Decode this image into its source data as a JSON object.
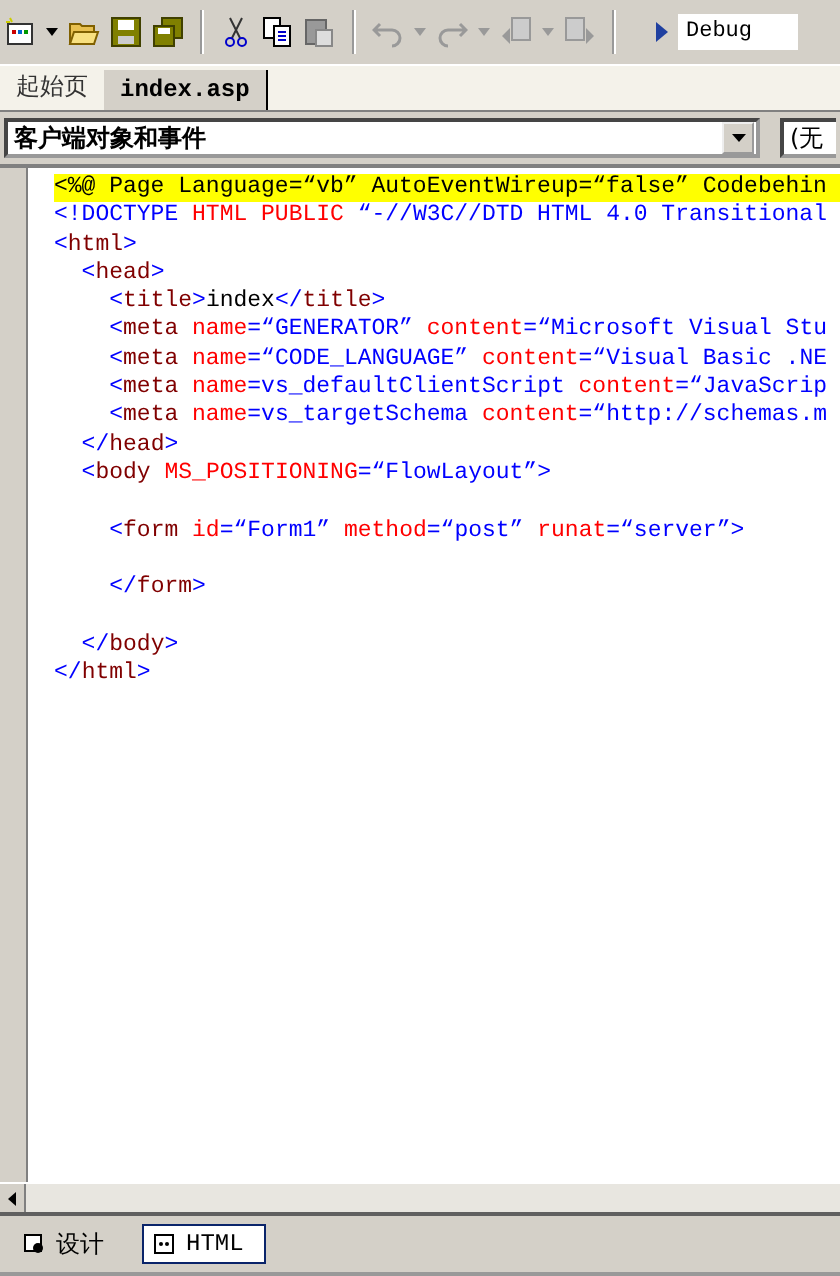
{
  "toolbar": {
    "configuration": "Debug"
  },
  "tabs": [
    {
      "label": "起始页",
      "selected": false
    },
    {
      "label": "index.asp",
      "selected": true
    }
  ],
  "object_dropdown": {
    "value": "客户端对象和事件"
  },
  "event_dropdown": {
    "value": "(无"
  },
  "code_lines": [
    {
      "highlighted": true,
      "tokens": [
        {
          "t": "<%@ Page Language=“vb” AutoEventWireup=“false” Codebehin",
          "kind": "plain"
        }
      ]
    },
    {
      "highlighted": false,
      "tokens": [
        {
          "t": "<!DOCTYPE ",
          "kind": "value"
        },
        {
          "t": "HTML PUBLIC ",
          "kind": "attr"
        },
        {
          "t": "“-//W3C//DTD HTML 4.0 Transitional",
          "kind": "value"
        }
      ]
    },
    {
      "highlighted": false,
      "tokens": [
        {
          "t": "<",
          "kind": "value"
        },
        {
          "t": "html",
          "kind": "tag"
        },
        {
          "t": ">",
          "kind": "value"
        }
      ]
    },
    {
      "highlighted": false,
      "tokens": [
        {
          "t": "  <",
          "kind": "value"
        },
        {
          "t": "head",
          "kind": "tag"
        },
        {
          "t": ">",
          "kind": "value"
        }
      ]
    },
    {
      "highlighted": false,
      "tokens": [
        {
          "t": "    <",
          "kind": "value"
        },
        {
          "t": "title",
          "kind": "tag"
        },
        {
          "t": ">",
          "kind": "value"
        },
        {
          "t": "index",
          "kind": "plain"
        },
        {
          "t": "</",
          "kind": "value"
        },
        {
          "t": "title",
          "kind": "tag"
        },
        {
          "t": ">",
          "kind": "value"
        }
      ]
    },
    {
      "highlighted": false,
      "tokens": [
        {
          "t": "    <",
          "kind": "value"
        },
        {
          "t": "meta ",
          "kind": "tag"
        },
        {
          "t": "name",
          "kind": "attr"
        },
        {
          "t": "=“GENERATOR” ",
          "kind": "value"
        },
        {
          "t": "content",
          "kind": "attr"
        },
        {
          "t": "=“Microsoft Visual Stu",
          "kind": "value"
        }
      ]
    },
    {
      "highlighted": false,
      "tokens": [
        {
          "t": "    <",
          "kind": "value"
        },
        {
          "t": "meta ",
          "kind": "tag"
        },
        {
          "t": "name",
          "kind": "attr"
        },
        {
          "t": "=“CODE_LANGUAGE” ",
          "kind": "value"
        },
        {
          "t": "content",
          "kind": "attr"
        },
        {
          "t": "=“Visual Basic .NE",
          "kind": "value"
        }
      ]
    },
    {
      "highlighted": false,
      "tokens": [
        {
          "t": "    <",
          "kind": "value"
        },
        {
          "t": "meta ",
          "kind": "tag"
        },
        {
          "t": "name",
          "kind": "attr"
        },
        {
          "t": "=vs_defaultClientScript ",
          "kind": "value"
        },
        {
          "t": "content",
          "kind": "attr"
        },
        {
          "t": "=“JavaScrip",
          "kind": "value"
        }
      ]
    },
    {
      "highlighted": false,
      "tokens": [
        {
          "t": "    <",
          "kind": "value"
        },
        {
          "t": "meta ",
          "kind": "tag"
        },
        {
          "t": "name",
          "kind": "attr"
        },
        {
          "t": "=vs_targetSchema ",
          "kind": "value"
        },
        {
          "t": "content",
          "kind": "attr"
        },
        {
          "t": "=“http://schemas.m",
          "kind": "value"
        }
      ]
    },
    {
      "highlighted": false,
      "tokens": [
        {
          "t": "  </",
          "kind": "value"
        },
        {
          "t": "head",
          "kind": "tag"
        },
        {
          "t": ">",
          "kind": "value"
        }
      ]
    },
    {
      "highlighted": false,
      "tokens": [
        {
          "t": "  <",
          "kind": "value"
        },
        {
          "t": "body ",
          "kind": "tag"
        },
        {
          "t": "MS_POSITIONING",
          "kind": "attr"
        },
        {
          "t": "=“FlowLayout”>",
          "kind": "value"
        }
      ]
    },
    {
      "highlighted": false
    },
    {
      "highlighted": false,
      "tokens": [
        {
          "t": "    <",
          "kind": "value"
        },
        {
          "t": "form ",
          "kind": "tag"
        },
        {
          "t": "id",
          "kind": "attr"
        },
        {
          "t": "=“Form1” ",
          "kind": "value"
        },
        {
          "t": "method",
          "kind": "attr"
        },
        {
          "t": "=“post” ",
          "kind": "value"
        },
        {
          "t": "runat",
          "kind": "attr"
        },
        {
          "t": "=“server”>",
          "kind": "value"
        }
      ]
    },
    {
      "highlighted": false
    },
    {
      "highlighted": false,
      "tokens": [
        {
          "t": "    </",
          "kind": "value"
        },
        {
          "t": "form",
          "kind": "tag"
        },
        {
          "t": ">",
          "kind": "value"
        }
      ]
    },
    {
      "highlighted": false
    },
    {
      "highlighted": false,
      "tokens": [
        {
          "t": "  </",
          "kind": "value"
        },
        {
          "t": "body",
          "kind": "tag"
        },
        {
          "t": ">",
          "kind": "value"
        }
      ]
    },
    {
      "highlighted": false,
      "tokens": [
        {
          "t": "</",
          "kind": "value"
        },
        {
          "t": "html",
          "kind": "tag"
        },
        {
          "t": ">",
          "kind": "value"
        }
      ]
    }
  ],
  "view_tabs": [
    {
      "label": "设计",
      "selected": false
    },
    {
      "label": "HTML",
      "selected": true
    }
  ]
}
